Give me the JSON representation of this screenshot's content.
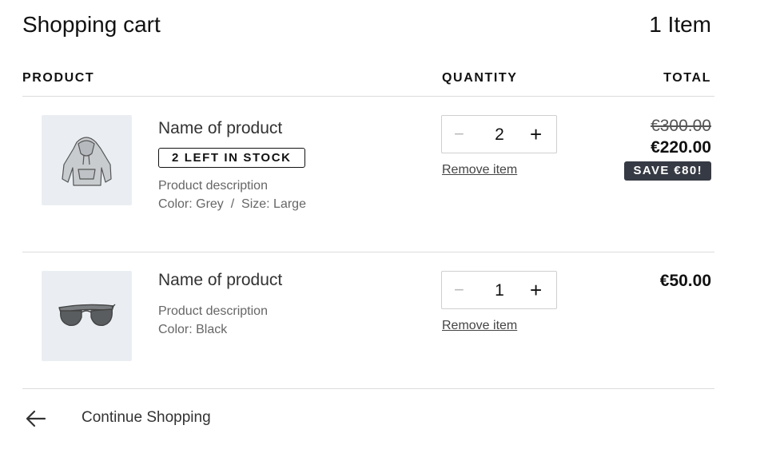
{
  "header": {
    "title": "Shopping cart",
    "item_count": "1 Item"
  },
  "columns": {
    "product": "PRODUCT",
    "quantity": "QUANTITY",
    "total": "TOTAL"
  },
  "items": [
    {
      "name": "Name of product",
      "stock_badge": "2 LEFT IN STOCK",
      "description": "Product description",
      "variant": "Color: Grey  /  Size: Large",
      "image_icon": "hoodie-icon",
      "quantity": "2",
      "remove_label": "Remove item",
      "original_price": "€300.00",
      "price": "€220.00",
      "savings_badge": "SAVE €80!"
    },
    {
      "name": "Name of product",
      "description": "Product description",
      "variant": "Color: Black",
      "image_icon": "sunglasses-icon",
      "quantity": "1",
      "remove_label": "Remove item",
      "price": "€50.00"
    }
  ],
  "stepper": {
    "minus": "−",
    "plus": "+"
  },
  "footer": {
    "continue_label": "Continue Shopping",
    "back_icon": "arrow-left-icon"
  },
  "colors": {
    "thumb_bg": "#eaeef3",
    "badge_bg": "#363a44",
    "divider": "#dcdcdc"
  }
}
